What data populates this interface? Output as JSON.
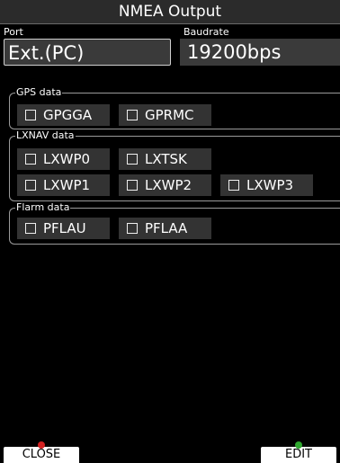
{
  "title": "NMEA Output",
  "port": {
    "label": "Port",
    "value": "Ext.(PC)"
  },
  "baudrate": {
    "label": "Baudrate",
    "value": "19200bps"
  },
  "groups": [
    {
      "label": "GPS data",
      "items": [
        "GPGGA",
        "GPRMC"
      ]
    },
    {
      "label": "LXNAV data",
      "items": [
        "LXWP0",
        "LXTSK",
        "LXWP1",
        "LXWP2",
        "LXWP3"
      ]
    },
    {
      "label": "Flarm data",
      "items": [
        "PFLAU",
        "PFLAA"
      ]
    }
  ],
  "softkeys": {
    "close": {
      "label": "CLOSE",
      "led_color": "#d32222"
    },
    "edit": {
      "label": "EDIT",
      "led_color": "#2fa82f"
    }
  }
}
